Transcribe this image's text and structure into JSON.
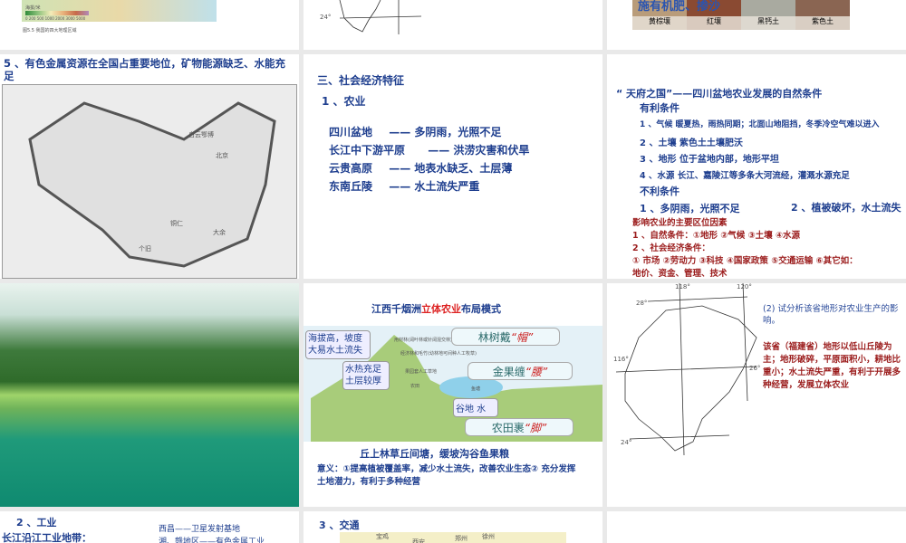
{
  "slides": [
    {
      "caption": "图5.5 我国的四大地理区域",
      "legend_label": "海拔/米",
      "legend_ticks": "0 200 500 1000 2000 3000 5000"
    },
    {
      "lat": "24°"
    },
    {
      "overlay": "施有机肥、掺沙",
      "soils": [
        "黄棕壤",
        "红壤",
        "黑钙土",
        "紫色土"
      ]
    },
    {
      "title": "5 、有色金属资源在全国占重要地位，矿物能源缺乏、水能充足",
      "map_places": [
        "白云鄂博",
        "北京",
        "个旧",
        "铜仁",
        "大余"
      ]
    },
    {
      "heading": "三、社会经济特征",
      "sub": "1 、农业",
      "rows": [
        {
          "region": "四川盆地",
          "dash": "——",
          "issue": "多阴雨，光照不足"
        },
        {
          "region": "长江中下游平原",
          "dash": "——",
          "issue": "洪涝灾害和伏旱"
        },
        {
          "region": "云贵高原",
          "dash": "——",
          "issue": "地表水缺乏、土层薄"
        },
        {
          "region": "东南丘陵",
          "dash": "——",
          "issue": "水土流失严重"
        }
      ]
    },
    {
      "title": "“ 天府之国”——四川盆地农业发展的自然条件",
      "fav": "有利条件",
      "fav_items": [
        "1 、气候 暖夏热，雨热同期；北面山地阻挡，冬季冷空气难以进入",
        "2 、土壤 紫色土土壤肥沃",
        "3 、地形 位于盆地内部，地形平坦",
        "4 、水源 长江、嘉陵江等多条大河流经，灌溉水源充足"
      ],
      "unfav": "不利条件",
      "unfav_items": [
        "1 、多阴雨，光照不足",
        "2 、植被破坏，水土流失"
      ],
      "factors": [
        "影响农业的主要区位因素",
        "1 、自然条件：①地形 ②气候 ③土壤 ④水源",
        "2 、社会经济条件：",
        "① 市场 ②劳动力 ③科技 ④国家政策 ⑤交通运输 ⑥其它如：",
        "地价、资金、管理、技术"
      ]
    },
    {},
    {
      "title_a": "江西千烟洲",
      "title_b": "立体农业",
      "title_c": "布局模式",
      "box1": "海拔高，坡度大易水土流失",
      "box2": "水热充足土层较厚",
      "box3": "谷地 水",
      "tag1": "林树戴",
      "tag1q": "“帽”",
      "tag2": "金果缠",
      "tag2q": "“腰”",
      "tag3": "农田裹",
      "tag3q": "“脚”",
      "lbl_forest": "用材林(阔叶林或针阔混交林)",
      "lbl_econ": "经济林和毛竹(幼林地可间种人工牧草)",
      "lbl_orchard": "果园套人工草地",
      "lbl_field": "农田",
      "lbl_pond": "鱼塘",
      "slogan": "丘上林草丘间塘，缓坡沟谷鱼果粮",
      "meaning": "意义：①提高植被覆盖率，减少水土流失，改善农业生态② 充分发挥土地潜力，有利于多种经营"
    },
    {
      "lon1": "118°",
      "lon2": "120°",
      "lat1": "28°",
      "lat2": "26°",
      "lat3": "24°",
      "lon0": "116°",
      "q": "(2) 试分析该省地形对农业生产的影响。",
      "answer": "该省（福建省）地形以低山丘陵为主；地形破碎，平原面积小，耕地比重小；水土流失严重，有利于开展多种经营，发展立体农业"
    },
    {
      "h": "2 、工业",
      "belt": "长江沿江工业地带：",
      "l1": "西昌——卫星发射基地",
      "l2": "湘、赣地区——有色金属工业"
    },
    {
      "h": "3 、交通",
      "cities": [
        "宝鸡",
        "西安",
        "郑州",
        "徐州"
      ]
    },
    {}
  ]
}
